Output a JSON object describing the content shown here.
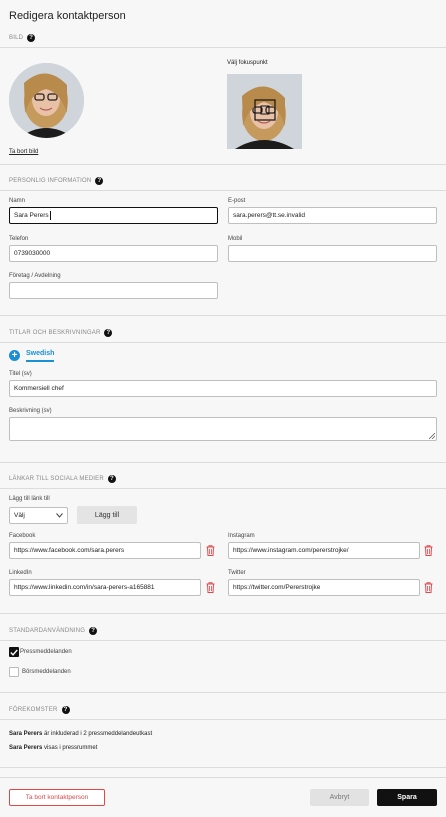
{
  "header": {
    "title": "Redigera kontaktperson"
  },
  "image_section": {
    "heading": "BILD",
    "remove_link": "Ta bort bild",
    "focus_label": "Välj fokuspunkt"
  },
  "personal": {
    "heading": "PERSONLIG INFORMATION",
    "name_label": "Namn",
    "name_value": "Sara Perers",
    "email_label": "E-post",
    "email_value": "sara.perers@tt.se.invalid",
    "phone_label": "Telefon",
    "phone_value": "0739030000",
    "mobile_label": "Mobil",
    "mobile_value": "",
    "company_label": "Företag / Avdelning",
    "company_value": ""
  },
  "titles": {
    "heading": "TITLAR OCH BESKRIVNINGAR",
    "language_tab": "Swedish",
    "title_label": "Titel (sv)",
    "title_value": "Kommersiell chef",
    "desc_label": "Beskrivning (sv)",
    "desc_value": ""
  },
  "social": {
    "heading": "LÄNKAR TILL SOCIALA MEDIER",
    "add_label": "Lägg till länk till",
    "select_value": "Välj",
    "add_button": "Lägg till",
    "facebook_label": "Facebook",
    "facebook_value": "https://www.facebook.com/sara.perers",
    "instagram_label": "Instagram",
    "instagram_value": "https://www.instagram.com/pererstrojke/",
    "linkedin_label": "LinkedIn",
    "linkedin_value": "https://www.linkedin.com/in/sara-perers-a165881",
    "twitter_label": "Twitter",
    "twitter_value": "https://twitter.com/Pererstrojke"
  },
  "default_use": {
    "heading": "STANDARDANVÄNDNING",
    "opt1_label": "Pressmeddelanden",
    "opt1_checked": true,
    "opt2_label": "Börsmeddelanden",
    "opt2_checked": false
  },
  "occurrences": {
    "heading": "FÖREKOMSTER",
    "line1_name": "Sara Perers",
    "line1_rest": " är inkluderad i 2 pressmeddelandeutkast",
    "line2_name": "Sara Perers",
    "line2_rest": " visas i pressrummet"
  },
  "footer": {
    "delete_button": "Ta bort kontaktperson",
    "cancel_button": "Avbryt",
    "save_button": "Spara"
  },
  "colors": {
    "accent": "#1a8fd6",
    "danger": "#e0484a",
    "dark": "#111111"
  }
}
